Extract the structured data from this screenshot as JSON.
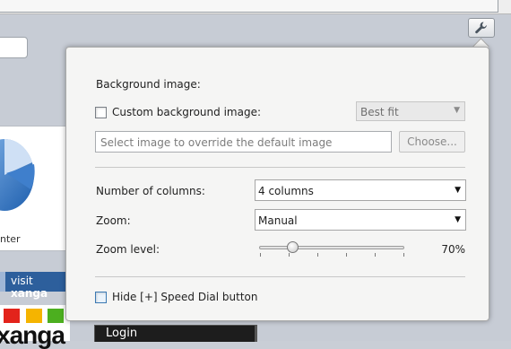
{
  "background": {
    "thumbnail_caption": "nter",
    "xanga_bar": {
      "prefix": "visit ",
      "brand": "xanga"
    },
    "xanga_logo_text": "xanga",
    "login_text": "Login"
  },
  "icons": {
    "wrench": "wrench-icon",
    "pie_chart": "pie-chart-icon",
    "dropdown_arrow": "chevron-down-icon"
  },
  "settings": {
    "background_section_title": "Background image:",
    "custom_background": {
      "label": "Custom background image:",
      "checked": false
    },
    "fit_select": {
      "value": "Best fit",
      "disabled": true
    },
    "image_input": {
      "placeholder": "Select image to override the default image",
      "value": ""
    },
    "choose_button": "Choose...",
    "columns": {
      "label": "Number of columns:",
      "value": "4 columns"
    },
    "zoom": {
      "label": "Zoom:",
      "value": "Manual"
    },
    "zoom_level": {
      "label": "Zoom level:",
      "value": "70%",
      "slider_fraction": 0.23
    },
    "hide_speed_dial": {
      "label": "Hide [+] Speed Dial button",
      "checked": false
    }
  },
  "colors": {
    "panel_bg": "#f5f5f4",
    "page_bg": "#c7ccd5",
    "xanga_blue": "#2d5f9c",
    "xanga_red": "#e3231b",
    "xanga_yellow": "#f5b400",
    "xanga_green": "#4caf1f"
  }
}
